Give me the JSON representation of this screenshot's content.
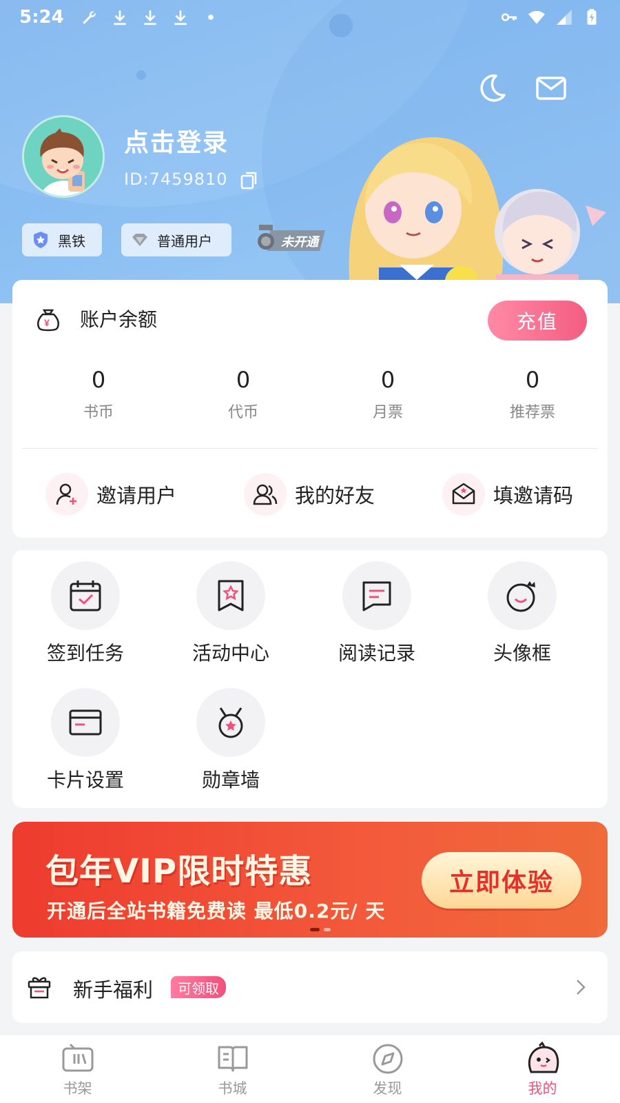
{
  "status_bar": {
    "time": "5:24"
  },
  "profile": {
    "login_text": "点击登录",
    "user_id": "ID:7459810",
    "badges": [
      {
        "label": "黑铁"
      },
      {
        "label": "普通用户"
      }
    ],
    "vip_tag": "未开通"
  },
  "balance": {
    "title": "账户余额",
    "recharge_label": "充值",
    "stats": [
      {
        "value": "0",
        "label": "书币"
      },
      {
        "value": "0",
        "label": "代币"
      },
      {
        "value": "0",
        "label": "月票"
      },
      {
        "value": "0",
        "label": "推荐票"
      }
    ],
    "actions": [
      {
        "label": "邀请用户",
        "icon": "add-user-icon"
      },
      {
        "label": "我的好友",
        "icon": "friends-icon"
      },
      {
        "label": "填邀请码",
        "icon": "invite-code-envelope-icon"
      }
    ]
  },
  "features": [
    {
      "label": "签到任务",
      "icon": "calendar-check-icon"
    },
    {
      "label": "活动中心",
      "icon": "star-bookmark-icon"
    },
    {
      "label": "阅读记录",
      "icon": "reading-record-icon"
    },
    {
      "label": "头像框",
      "icon": "avatar-frame-crown-icon"
    },
    {
      "label": "卡片设置",
      "icon": "card-icon"
    },
    {
      "label": "勋章墙",
      "icon": "medal-icon"
    }
  ],
  "banner": {
    "title": "包年VIP限时特惠",
    "subtitle": "开通后全站书籍免费读 最低0.2元/ 天",
    "button": "立即体验"
  },
  "newbie": {
    "title": "新手福利",
    "badge": "可领取"
  },
  "tabs": [
    {
      "label": "书架",
      "icon": "bookshelf-icon",
      "active": false
    },
    {
      "label": "书城",
      "icon": "book-store-icon",
      "active": false
    },
    {
      "label": "发现",
      "icon": "compass-icon",
      "active": false
    },
    {
      "label": "我的",
      "icon": "profile-mascot-icon",
      "active": true
    }
  ],
  "colors": {
    "header_blue": "#8cc0f3",
    "accent_pink": "#f0517b",
    "banner_red": "#ee3b2f"
  }
}
